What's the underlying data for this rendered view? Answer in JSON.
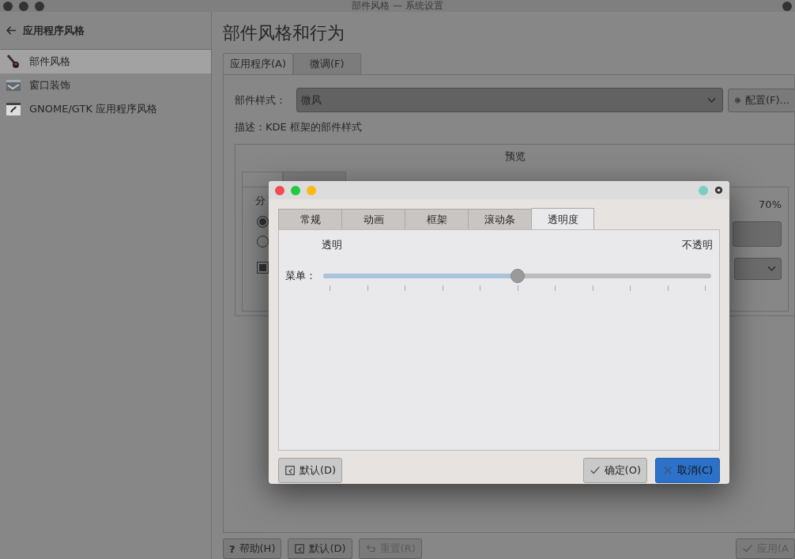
{
  "window": {
    "title": "部件风格 — 系统设置"
  },
  "sidebar": {
    "back_label": "应用程序风格",
    "items": [
      {
        "label": "部件风格",
        "selected": true,
        "kind": "brush"
      },
      {
        "label": "窗口装饰",
        "selected": false,
        "kind": "window"
      },
      {
        "label": "GNOME/GTK 应用程序风格",
        "selected": false,
        "kind": "gtk"
      }
    ]
  },
  "page": {
    "title": "部件风格和行为",
    "tabs": [
      {
        "label": "应用程序(A)",
        "selected": true
      },
      {
        "label": "微调(F)",
        "selected": false
      }
    ],
    "widget_style": {
      "label": "部件样式：",
      "value": "微风"
    },
    "configure_button": "配置(F)...",
    "description": "描述：KDE 框架的部件样式",
    "preview": {
      "title": "预览",
      "group_fragment": "分",
      "reading": "70%",
      "radios": [
        {
          "selected": true
        },
        {
          "selected": false
        }
      ],
      "checkbox": {
        "checked": true
      }
    }
  },
  "buttons": [
    {
      "label": "帮助(H)",
      "kind": "help",
      "icon": "?",
      "disabled": false
    },
    {
      "label": "默认(D)",
      "kind": "defaults",
      "disabled": false
    },
    {
      "label": "重置(R)",
      "kind": "reset",
      "disabled": true
    },
    {
      "label": "应用(A",
      "kind": "apply",
      "disabled": true
    }
  ],
  "dialog": {
    "tabs": [
      {
        "label": "常规",
        "selected": false
      },
      {
        "label": "动画",
        "selected": false
      },
      {
        "label": "框架",
        "selected": false
      },
      {
        "label": "滚动条",
        "selected": false
      },
      {
        "label": "透明度",
        "selected": true
      }
    ],
    "slider": {
      "label": "菜单：",
      "min_label": "透明",
      "max_label": "不透明",
      "level": 0.5
    },
    "buttons": [
      {
        "label": "默认(D)",
        "kind": "defaults"
      },
      {
        "label": "确定(O)",
        "kind": "ok"
      },
      {
        "label": "取消(C)",
        "kind": "cancel"
      }
    ]
  }
}
